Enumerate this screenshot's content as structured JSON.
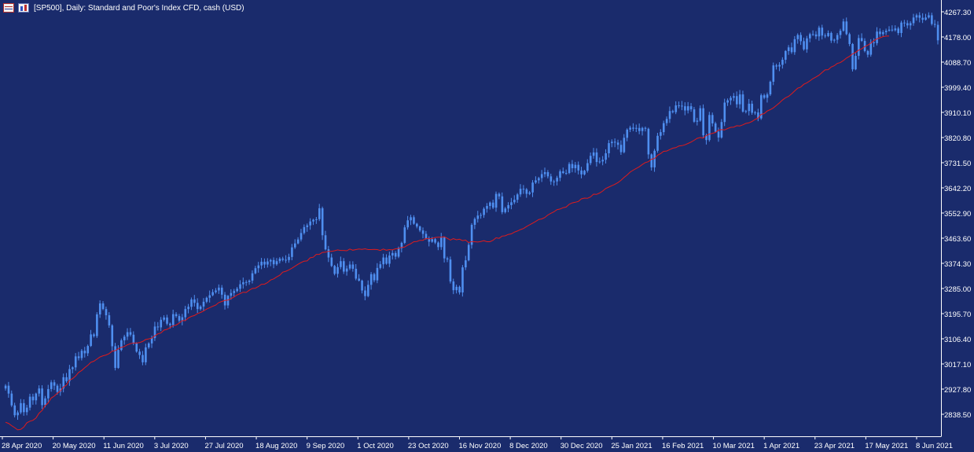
{
  "window": {
    "title": "[SP500], Daily:  Standard and Poor's Index CFD, cash (USD)"
  },
  "colors": {
    "background": "#1a2b6c",
    "candle": "#4f8ff0",
    "ma_line": "#e01b1b",
    "axis_text": "#ffffff",
    "axis_line": "#ffffff"
  },
  "chart_data": {
    "type": "candlestick",
    "title": "[SP500], Daily:  Standard and Poor's Index CFD, cash (USD)",
    "ylim": [
      2770,
      4290
    ],
    "yticks": [
      {
        "label": "4267.30",
        "value": 4267.3
      },
      {
        "label": "4178.00",
        "value": 4178.0
      },
      {
        "label": "4088.70",
        "value": 4088.7
      },
      {
        "label": "3999.40",
        "value": 3999.4
      },
      {
        "label": "3910.10",
        "value": 3910.1
      },
      {
        "label": "3820.80",
        "value": 3820.8
      },
      {
        "label": "3731.50",
        "value": 3731.5
      },
      {
        "label": "3642.20",
        "value": 3642.2
      },
      {
        "label": "3552.90",
        "value": 3552.9
      },
      {
        "label": "3463.60",
        "value": 3463.6
      },
      {
        "label": "3374.30",
        "value": 3374.3
      },
      {
        "label": "3285.00",
        "value": 3285.0
      },
      {
        "label": "3195.70",
        "value": 3195.7
      },
      {
        "label": "3106.40",
        "value": 3106.4
      },
      {
        "label": "3017.10",
        "value": 3017.1
      },
      {
        "label": "2927.80",
        "value": 2927.8
      },
      {
        "label": "2838.50",
        "value": 2838.5
      }
    ],
    "x_dates": [
      "28 Apr 2020",
      "20 May 2020",
      "11 Jun 2020",
      "3 Jul 2020",
      "27 Jul 2020",
      "18 Aug 2020",
      "9 Sep 2020",
      "1 Oct 2020",
      "23 Oct 2020",
      "16 Nov 2020",
      "8 Dec 2020",
      "30 Dec 2020",
      "25 Jan 2021",
      "16 Feb 2021",
      "10 Mar 2021",
      "1 Apr 2021",
      "23 Apr 2021",
      "17 May 2021",
      "8 Jun 2021"
    ],
    "series": [
      {
        "type": "candlestick",
        "close": [
          2940,
          2912,
          2870,
          2835,
          2845,
          2878,
          2846,
          2862,
          2901,
          2888,
          2912,
          2930,
          2871,
          2895,
          2928,
          2952,
          2940,
          2918,
          2930,
          2970,
          2956,
          2999,
          3005,
          3044,
          3038,
          3064,
          3055,
          3081,
          3122,
          3116,
          3193,
          3232,
          3212,
          3190,
          3154,
          3080,
          3003,
          3067,
          3101,
          3114,
          3130,
          3121,
          3090,
          3061,
          3049,
          3023,
          3076,
          3090,
          3109,
          3150,
          3147,
          3174,
          3182,
          3160,
          3155,
          3194,
          3187,
          3171,
          3183,
          3212,
          3220,
          3246,
          3234,
          3212,
          3221,
          3238,
          3252,
          3261,
          3272,
          3278,
          3288,
          3263,
          3225,
          3259,
          3269,
          3276,
          3284,
          3300,
          3307,
          3308,
          3313,
          3339,
          3357,
          3367,
          3380,
          3370,
          3381,
          3386,
          3371,
          3382,
          3391,
          3387,
          3386,
          3397,
          3431,
          3445,
          3459,
          3482,
          3503,
          3509,
          3523,
          3529,
          3531,
          3570,
          3474,
          3424,
          3395,
          3365,
          3337,
          3361,
          3382,
          3345,
          3356,
          3370,
          3355,
          3320,
          3313,
          3278,
          3258,
          3298,
          3336,
          3314,
          3358,
          3371,
          3395,
          3373,
          3402,
          3411,
          3398,
          3428,
          3447,
          3502,
          3527,
          3538,
          3515,
          3505,
          3491,
          3479,
          3462,
          3451,
          3460,
          3448,
          3432,
          3466,
          3392,
          3388,
          3310,
          3279,
          3291,
          3271,
          3360,
          3385,
          3440,
          3511,
          3532,
          3544,
          3546,
          3568,
          3578,
          3590,
          3572,
          3621,
          3612,
          3556,
          3569,
          3581,
          3591,
          3600,
          3619,
          3639,
          3637,
          3621,
          3626,
          3661,
          3669,
          3677,
          3691,
          3698,
          3683,
          3665,
          3665,
          3678,
          3701,
          3695,
          3695,
          3727,
          3712,
          3724,
          3704,
          3690,
          3703,
          3730,
          3756,
          3768,
          3734,
          3736,
          3742,
          3765,
          3801,
          3806,
          3803,
          3795,
          3769,
          3820,
          3849,
          3856,
          3852,
          3855,
          3844,
          3855,
          3852,
          3761,
          3715,
          3774,
          3827,
          3840,
          3872,
          3887,
          3915,
          3911,
          3935,
          3934,
          3932,
          3917,
          3932,
          3921,
          3877,
          3881,
          3925,
          3829,
          3812,
          3901,
          3871,
          3842,
          3821,
          3876,
          3945,
          3953,
          3962,
          3968,
          3939,
          3974,
          3913,
          3915,
          3941,
          3909,
          3910,
          3889,
          3971,
          3962,
          3974,
          4019,
          4077,
          4073,
          4079,
          4097,
          4128,
          4141,
          4124,
          4170,
          4185,
          4163,
          4134,
          4173,
          4188,
          4187,
          4180,
          4211,
          4183,
          4181,
          4192,
          4165,
          4168,
          4185,
          4200,
          4233,
          4188,
          4153,
          4063,
          4111,
          4174,
          4164,
          4128,
          4115,
          4159,
          4156,
          4197,
          4188,
          4195,
          4200,
          4204,
          4202,
          4208,
          4192,
          4229,
          4227,
          4219,
          4227,
          4247,
          4255,
          4246,
          4239,
          4247,
          4255,
          4224,
          4221,
          4166
        ],
        "ma": [
          2810,
          2806,
          2798,
          2791,
          2783,
          2785,
          2793,
          2808,
          2814,
          2817,
          2825,
          2842,
          2852,
          2869,
          2879,
          2896,
          2903,
          2913,
          2921,
          2935,
          2942,
          2960,
          2965,
          2974,
          2987,
          2994,
          3004,
          3012,
          3023,
          3027,
          3034,
          3042,
          3046,
          3049,
          3054,
          3063,
          3064,
          3071,
          3076,
          3079,
          3085,
          3089,
          3092,
          3091,
          3093,
          3097,
          3104,
          3106,
          3109,
          3117,
          3124,
          3127,
          3137,
          3140,
          3146,
          3153,
          3155,
          3162,
          3171,
          3171,
          3180,
          3186,
          3189,
          3196,
          3200,
          3205,
          3212,
          3217,
          3222,
          3226,
          3235,
          3239,
          3243,
          3244,
          3249,
          3255,
          3262,
          3267,
          3272,
          3271,
          3279,
          3285,
          3286,
          3292,
          3300,
          3300,
          3306,
          3315,
          3319,
          3326,
          3332,
          3343,
          3346,
          3351,
          3357,
          3364,
          3371,
          3377,
          3382,
          3383,
          3394,
          3396,
          3406,
          3406,
          3413,
          3414,
          3417,
          3417,
          3419,
          3422,
          3420,
          3420,
          3419,
          3425,
          3421,
          3423,
          3425,
          3424,
          3426,
          3423,
          3423,
          3424,
          3423,
          3420,
          3425,
          3421,
          3423,
          3422,
          3426,
          3427,
          3431,
          3432,
          3439,
          3444,
          3451,
          3452,
          3456,
          3456,
          3463,
          3461,
          3463,
          3466,
          3467,
          3467,
          3469,
          3463,
          3457,
          3462,
          3458,
          3460,
          3455,
          3457,
          3448,
          3452,
          3451,
          3450,
          3452,
          3455,
          3451,
          3451,
          3456,
          3465,
          3463,
          3471,
          3472,
          3477,
          3479,
          3485,
          3489,
          3494,
          3498,
          3505,
          3511,
          3517,
          3523,
          3530,
          3532,
          3537,
          3546,
          3552,
          3557,
          3565,
          3567,
          3572,
          3574,
          3584,
          3589,
          3591,
          3594,
          3603,
          3606,
          3605,
          3610,
          3620,
          3619,
          3624,
          3631,
          3640,
          3645,
          3650,
          3655,
          3661,
          3669,
          3679,
          3688,
          3698,
          3705,
          3711,
          3717,
          3725,
          3732,
          3735,
          3744,
          3746,
          3758,
          3764,
          3772,
          3773,
          3778,
          3783,
          3785,
          3791,
          3792,
          3795,
          3800,
          3805,
          3811,
          3818,
          3821,
          3819,
          3828,
          3833,
          3836,
          3839,
          3847,
          3849,
          3848,
          3853,
          3857,
          3858,
          3863,
          3862,
          3866,
          3871,
          3873,
          3878,
          3885,
          3890,
          3903,
          3906,
          3915,
          3920,
          3926,
          3935,
          3944,
          3954,
          3962,
          3967,
          3976,
          3986,
          3996,
          4000,
          4010,
          4015,
          4022,
          4030,
          4036,
          4042,
          4052,
          4061,
          4062,
          4071,
          4076,
          4084,
          4087,
          4094,
          4103,
          4109,
          4118,
          4123,
          4131,
          4136,
          4144,
          4149,
          4156,
          4165,
          4171,
          4175,
          4179,
          4181,
          4181
        ]
      }
    ]
  }
}
